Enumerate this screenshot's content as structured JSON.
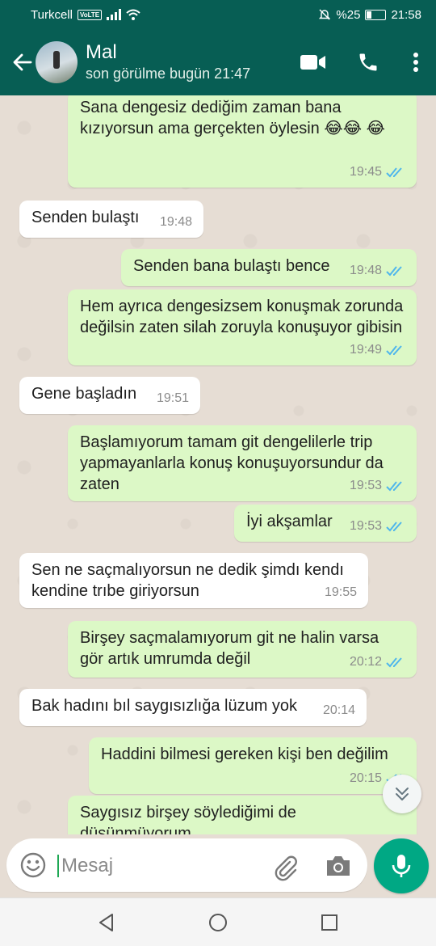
{
  "status_bar": {
    "carrier": "Turkcell",
    "volte": "VoLTE",
    "battery_percent": "%25",
    "time": "21:58"
  },
  "header": {
    "contact_name": "Mal",
    "last_seen": "son görülme bugün 21:47"
  },
  "messages": [
    {
      "direction": "out",
      "text": "Sana dengesiz dediğim zaman bana kızıyorsun ama gerçekten öylesin 😂😂 😂",
      "time": "19:45",
      "read": true
    },
    {
      "direction": "in",
      "text": "Senden bulaştı",
      "time": "19:48"
    },
    {
      "direction": "out",
      "text": "Senden bana bulaştı bence",
      "time": "19:48",
      "read": true
    },
    {
      "direction": "out",
      "text": "Hem ayrıca dengesizsem konuşmak zorunda değilsin zaten silah zoruyla konuşuyor gibisin",
      "time": "19:49",
      "read": true
    },
    {
      "direction": "in",
      "text": "Gene başladın",
      "time": "19:51"
    },
    {
      "direction": "out",
      "text": "Başlamıyorum tamam git dengelilerle trip yapmayanlarla konuş konuşuyorsundur da zaten",
      "time": "19:53",
      "read": true
    },
    {
      "direction": "out",
      "text": "İyi akşamlar",
      "time": "19:53",
      "read": true
    },
    {
      "direction": "in",
      "text": "Sen ne saçmalıyorsun ne dedik şimdı kendı kendine trıbe giriyorsun",
      "time": "19:55"
    },
    {
      "direction": "out",
      "text": "Birşey saçmalamıyorum git ne halin varsa gör artık umrumda değil",
      "time": "20:12",
      "read": true
    },
    {
      "direction": "in",
      "text": "Bak hadını bıl saygısızlığa lüzum yok",
      "time": "20:14"
    },
    {
      "direction": "out",
      "text": "Haddini bilmesi gereken kişi ben değilim",
      "time": "20:15",
      "read": true
    },
    {
      "direction": "out",
      "text": "Saygısız birşey söylediğimi de düşünmüyorum",
      "time": ""
    }
  ],
  "input": {
    "placeholder": "Mesaj",
    "value": ""
  },
  "colors": {
    "header": "#075e54",
    "outgoing_bubble": "#dcf8c6",
    "incoming_bubble": "#ffffff",
    "read_tick": "#4fb6ec",
    "mic_button": "#00a884"
  },
  "icons": {
    "back": "arrow-left",
    "video": "video-camera",
    "call": "phone",
    "menu": "three-dots-vertical",
    "emoji": "smiley",
    "attach": "paperclip",
    "camera": "camera",
    "mic": "microphone",
    "scroll_down": "double-chevron-down"
  }
}
